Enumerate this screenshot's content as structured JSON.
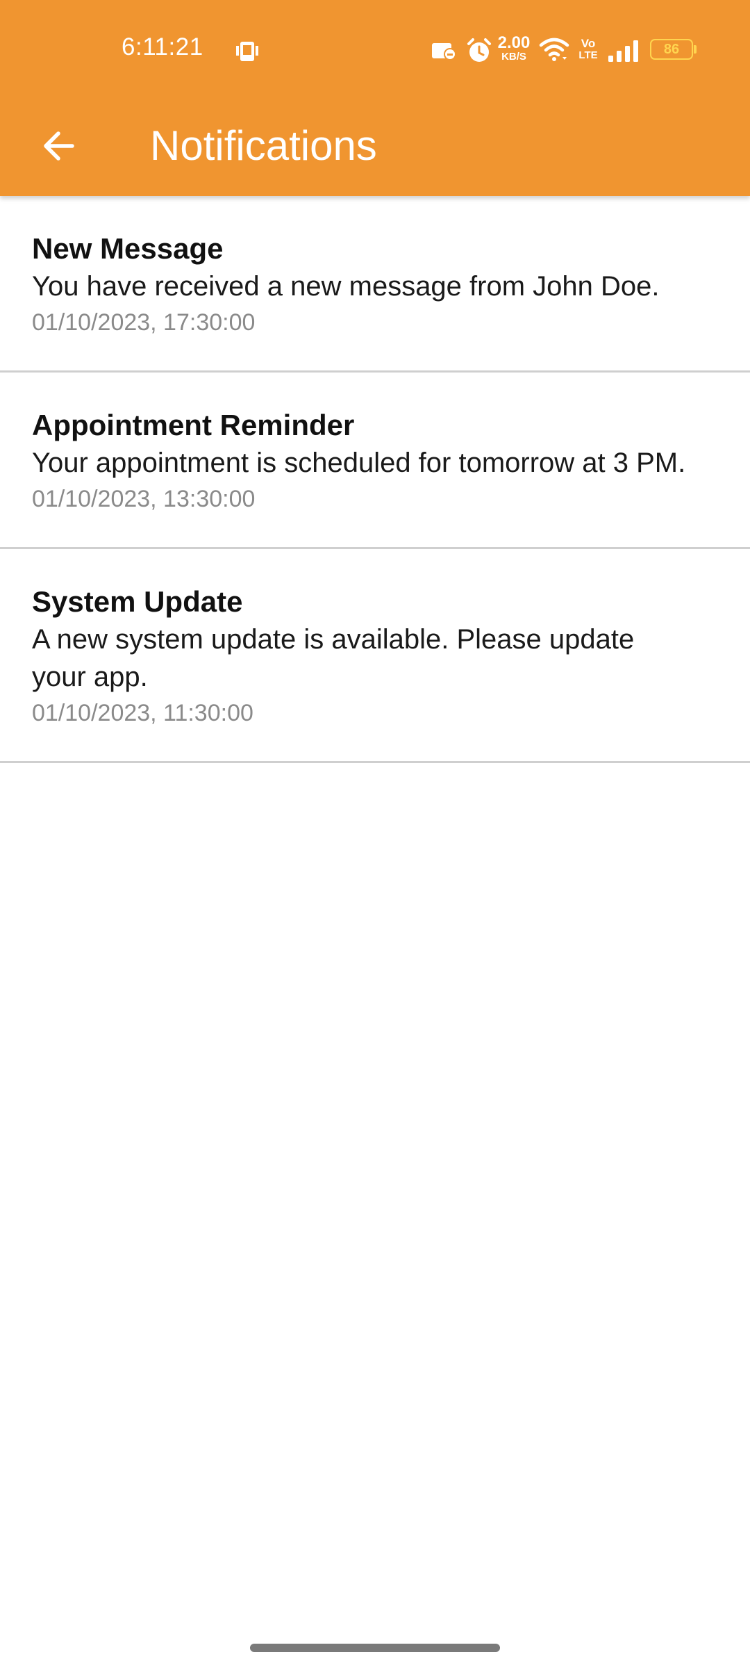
{
  "status_bar": {
    "time": "6:11:21",
    "net_speed_value": "2.00",
    "net_speed_unit": "KB/S",
    "volte_top": "Vo",
    "volte_bottom": "LTE",
    "battery": "86"
  },
  "toolbar": {
    "title": "Notifications",
    "back_icon": "arrow-left-icon"
  },
  "notifications": [
    {
      "title": "New Message",
      "body": "You have received a new message from John Doe.",
      "time": "01/10/2023, 17:30:00"
    },
    {
      "title": "Appointment Reminder",
      "body": "Your appointment is scheduled for tomorrow at 3 PM.",
      "time": "01/10/2023, 13:30:00"
    },
    {
      "title": "System Update",
      "body": "A new system update is available. Please update your app.",
      "time": "01/10/2023, 11:30:00"
    }
  ],
  "colors": {
    "app_bar": "#F09530",
    "battery_accent": "#FFD54F"
  }
}
